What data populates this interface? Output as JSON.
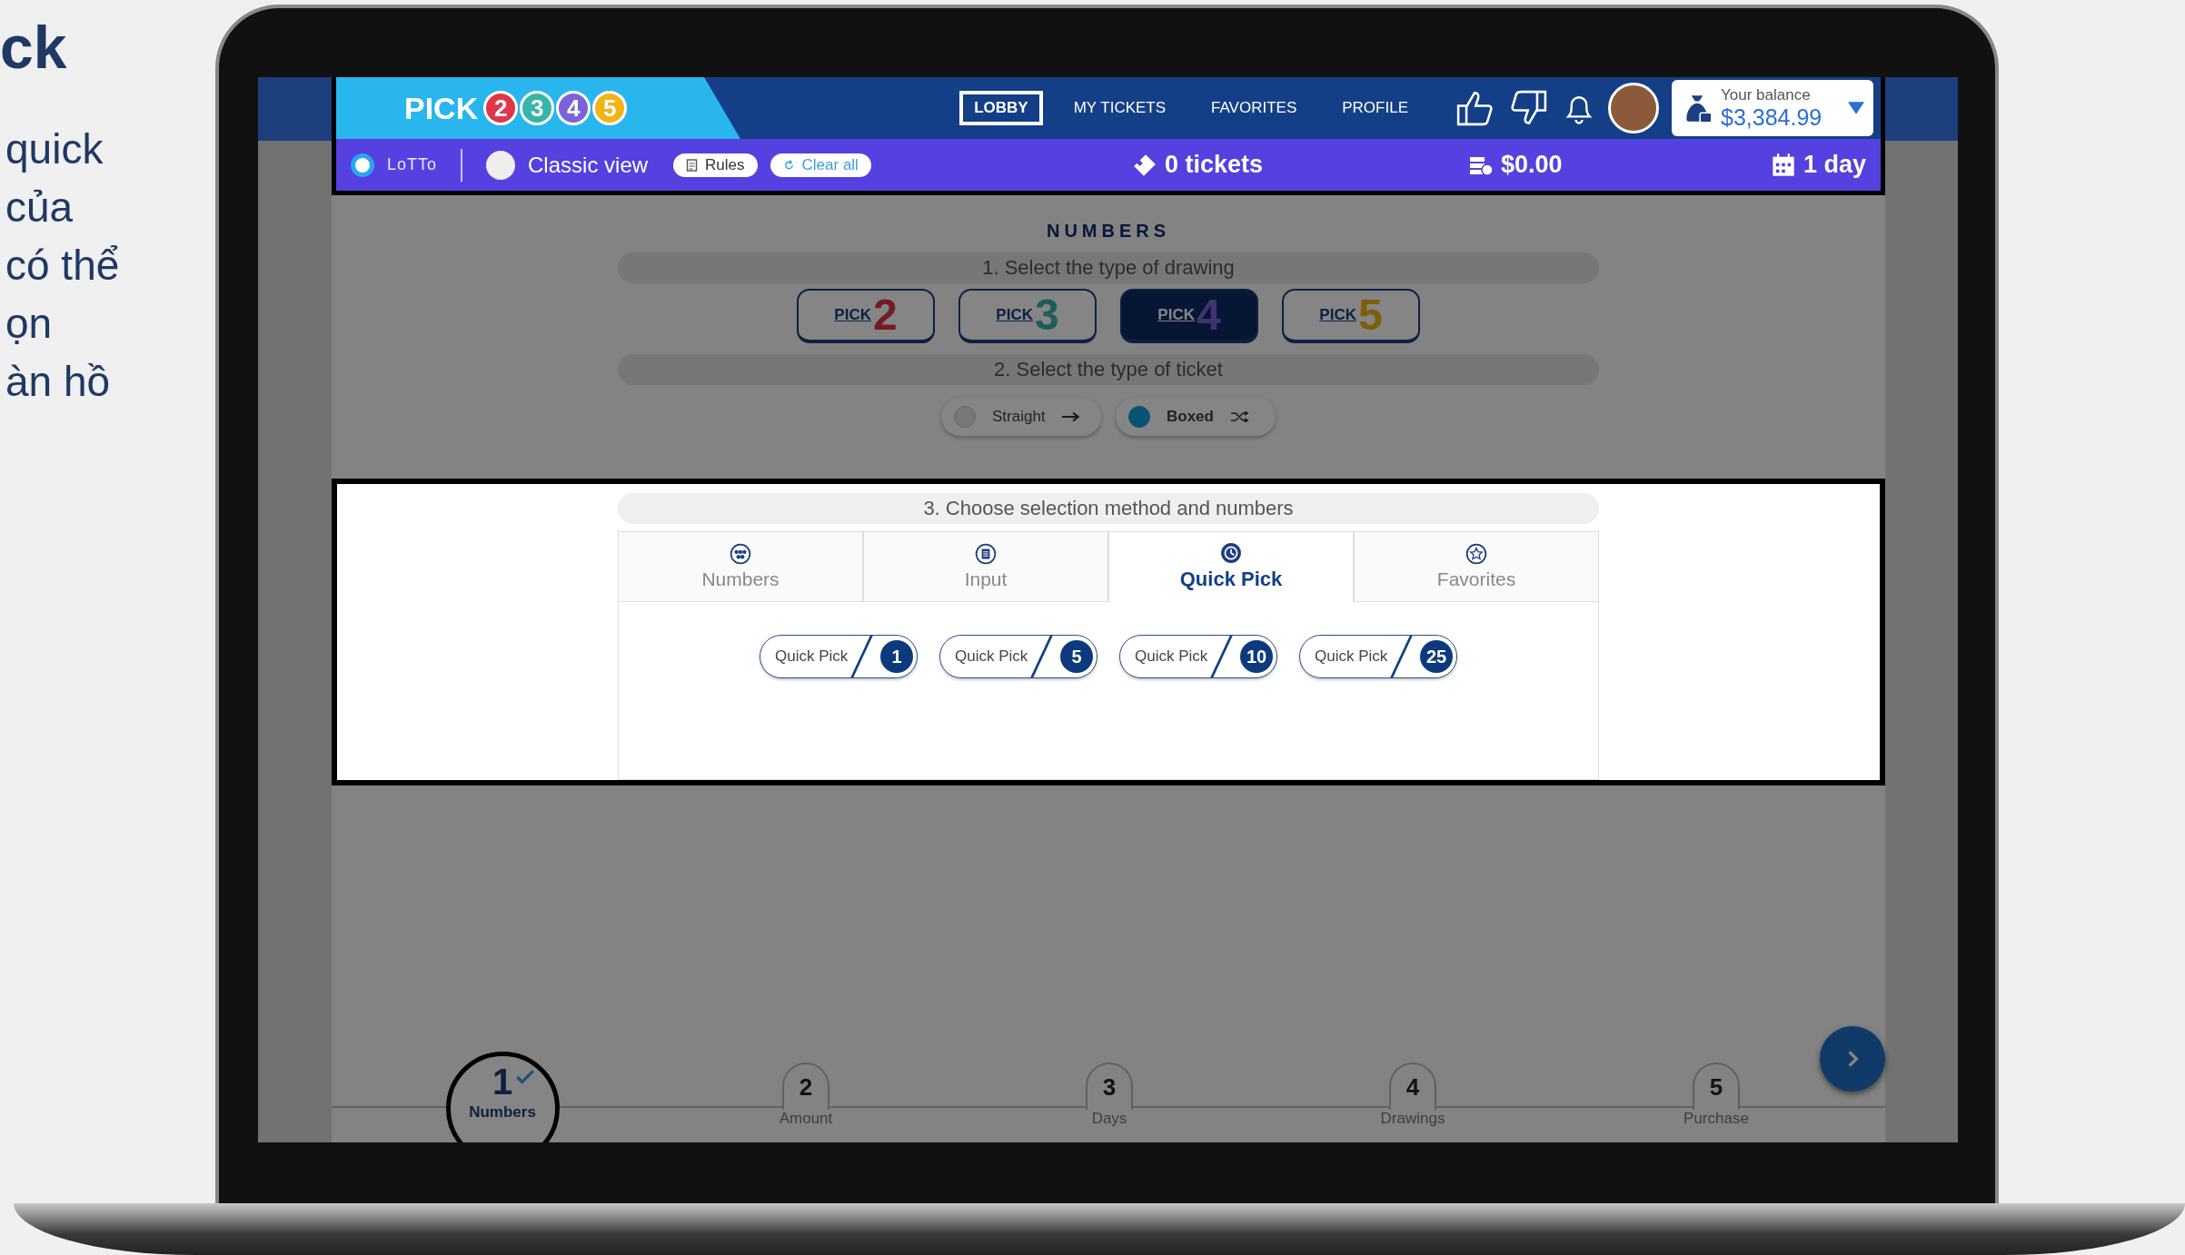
{
  "slide": {
    "title": "ck",
    "lines": [
      "quick",
      "của",
      "có thể",
      "ọn",
      "àn hồ"
    ]
  },
  "header": {
    "logo_word": "PICK",
    "logo_digits": [
      "2",
      "3",
      "4",
      "5"
    ],
    "nav": [
      {
        "label": "LOBBY",
        "selected": true
      },
      {
        "label": "MY TICKETS",
        "selected": false
      },
      {
        "label": "FAVORITES",
        "selected": false
      },
      {
        "label": "PROFILE",
        "selected": false
      }
    ],
    "balance_label": "Your balance",
    "balance": "$3,384.99"
  },
  "toolbar": {
    "lotto_selected": true,
    "lotto_logo": "LoTTo",
    "classic_view": false,
    "classic_label": "Classic view",
    "rules": "Rules",
    "clear_all": "Clear all",
    "tickets": "0 tickets",
    "total": "$0.00",
    "duration": "1 day"
  },
  "section_title": "NUMBERS",
  "drawing_heading": "1. Select the type of drawing",
  "drawing_types": [
    {
      "word": "PICK",
      "digit": "2",
      "selected": false
    },
    {
      "word": "PICK",
      "digit": "3",
      "selected": false
    },
    {
      "word": "PICK",
      "digit": "4",
      "selected": true
    },
    {
      "word": "PICK",
      "digit": "5",
      "selected": false
    }
  ],
  "ticket_heading": "2. Select the type of ticket",
  "ticket_types": [
    {
      "label": "Straight",
      "selected": false
    },
    {
      "label": "Boxed",
      "selected": true
    }
  ],
  "method_heading": "3. Choose selection method and numbers",
  "method_tabs": [
    {
      "label": "Numbers",
      "selected": false
    },
    {
      "label": "Input",
      "selected": false
    },
    {
      "label": "Quick Pick",
      "selected": true
    },
    {
      "label": "Favorites",
      "selected": false
    }
  ],
  "quick_picks": [
    {
      "label": "Quick Pick",
      "count": "1"
    },
    {
      "label": "Quick Pick",
      "count": "5"
    },
    {
      "label": "Quick Pick",
      "count": "10"
    },
    {
      "label": "Quick Pick",
      "count": "25"
    }
  ],
  "steps": [
    {
      "number": "1",
      "label": "Numbers",
      "selected": true
    },
    {
      "number": "2",
      "label": "Amount",
      "selected": false
    },
    {
      "number": "3",
      "label": "Days",
      "selected": false
    },
    {
      "number": "4",
      "label": "Drawings",
      "selected": false
    },
    {
      "number": "5",
      "label": "Purchase",
      "selected": false
    }
  ]
}
